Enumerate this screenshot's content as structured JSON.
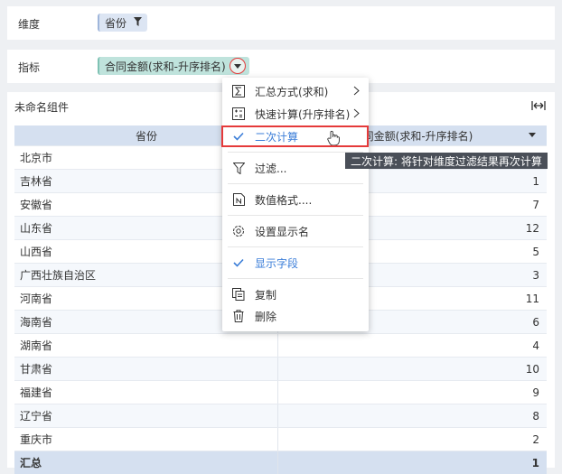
{
  "dimension": {
    "label": "维度",
    "field": "省份"
  },
  "metric": {
    "label": "指标",
    "field": "合同金额(求和-升序排名)"
  },
  "component": {
    "title": "未命名组件"
  },
  "table": {
    "headers": [
      "省份",
      "合同金额(求和-升序排名)"
    ],
    "rows": [
      {
        "province": "北京市",
        "value": ""
      },
      {
        "province": "吉林省",
        "value": "1"
      },
      {
        "province": "安徽省",
        "value": "7"
      },
      {
        "province": "山东省",
        "value": "12"
      },
      {
        "province": "山西省",
        "value": "5"
      },
      {
        "province": "广西壮族自治区",
        "value": "3"
      },
      {
        "province": "河南省",
        "value": "11"
      },
      {
        "province": "海南省",
        "value": "6"
      },
      {
        "province": "湖南省",
        "value": "4"
      },
      {
        "province": "甘肃省",
        "value": "10"
      },
      {
        "province": "福建省",
        "value": "9"
      },
      {
        "province": "辽宁省",
        "value": "8"
      },
      {
        "province": "重庆市",
        "value": "2"
      }
    ],
    "total": {
      "label": "汇总",
      "value": "1"
    }
  },
  "menu": {
    "items": [
      {
        "label": "汇总方式(求和)"
      },
      {
        "label": "快速计算(升序排名)"
      },
      {
        "label": "二次计算"
      },
      {
        "label": "过滤..."
      },
      {
        "label": "数值格式...."
      },
      {
        "label": "设置显示名"
      },
      {
        "label": "显示字段"
      },
      {
        "label": "复制"
      },
      {
        "label": "删除"
      }
    ]
  },
  "tooltip": {
    "text": "二次计算: 将针对维度过滤结果再次计算"
  },
  "colors": {
    "accent": "#3a7dd8",
    "highlight": "#e53a3a"
  }
}
